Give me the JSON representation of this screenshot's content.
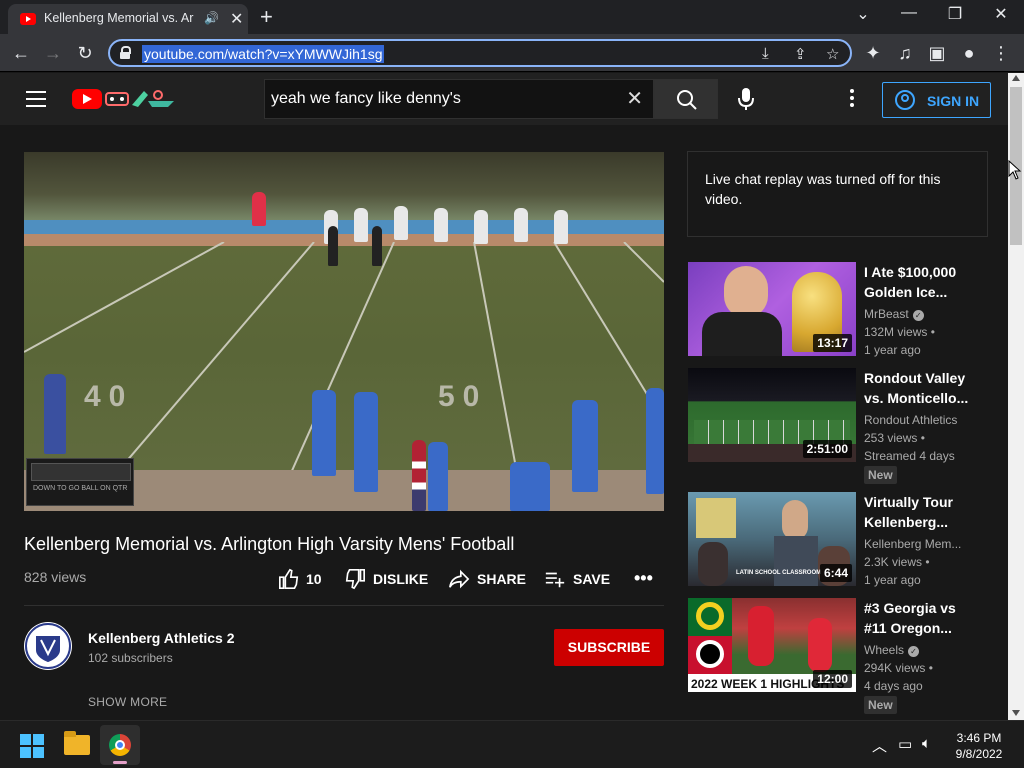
{
  "browser": {
    "tab_title": "Kellenberg Memorial vs. Arlin",
    "url": "youtube.com/watch?v=xYMWWJih1sg"
  },
  "youtube": {
    "search_query": "yeah we fancy like denny's",
    "sign_in_label": "SIGN IN"
  },
  "video": {
    "title": "Kellenberg Memorial vs. Arlington High Varsity Mens' Football",
    "views": "828 views",
    "like_count": "10",
    "dislike_label": "DISLIKE",
    "share_label": "SHARE",
    "save_label": "SAVE",
    "yard_left": "40",
    "yard_right": "50",
    "scoreboard_labels": "DOWN TO GO BALL ON QTR"
  },
  "channel": {
    "name": "Kellenberg Athletics 2",
    "subscribers": "102 subscribers",
    "subscribe_label": "SUBSCRIBE",
    "show_more_label": "SHOW MORE"
  },
  "chat": {
    "message": "Live chat replay was turned off for this video."
  },
  "recommendations": [
    {
      "title1": "I Ate $100,000",
      "title2": "Golden Ice...",
      "channel": "MrBeast",
      "verified": true,
      "meta1": "132M views •",
      "meta2": "1 year ago",
      "duration": "13:17",
      "badge": ""
    },
    {
      "title1": "Rondout Valley",
      "title2": "vs. Monticello...",
      "channel": "Rondout Athletics",
      "verified": false,
      "meta1": "253 views •",
      "meta2": "Streamed 4 days",
      "duration": "2:51:00",
      "badge": "New"
    },
    {
      "title1": "Virtually Tour",
      "title2": "Kellenberg...",
      "channel": "Kellenberg Mem...",
      "verified": false,
      "meta1": "2.3K views •",
      "meta2": "1 year ago",
      "duration": "6:44",
      "badge": "",
      "thumb_caption": "LATIN SCHOOL CLASSROOM"
    },
    {
      "title1": "#3 Georgia vs",
      "title2": "#11 Oregon...",
      "channel": "Wheels",
      "verified": true,
      "meta1": "294K views •",
      "meta2": "4 days ago",
      "duration": "12:00",
      "badge": "New",
      "thumb_caption": "2022 WEEK 1 HIGHLIGHTS"
    }
  ],
  "taskbar": {
    "time": "3:46 PM",
    "date": "9/8/2022"
  },
  "colors": {
    "yt_red": "#ff0000",
    "subscribe_red": "#cc0000",
    "link_blue": "#3ea6ff",
    "page_bg": "#181818"
  }
}
